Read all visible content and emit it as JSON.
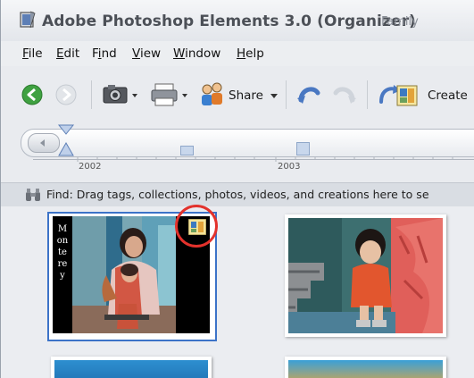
{
  "titlebar": {
    "title": "Adobe Photoshop Elements 3.0 (Organizer)",
    "subtitle": "Family"
  },
  "menu": {
    "items": [
      "File",
      "Edit",
      "Find",
      "View",
      "Window",
      "Help"
    ],
    "underline": [
      "F",
      "E",
      "i",
      "V",
      "W",
      "H"
    ]
  },
  "toolbar": {
    "share_label": "Share",
    "create_label": "Create"
  },
  "timeline": {
    "years": [
      "2002",
      "2003"
    ]
  },
  "findbar": {
    "text": "Find: Drag tags, collections, photos, videos, and creations here to se"
  },
  "photos": [
    {
      "caption_vertical": "Monterey",
      "selected": true,
      "has_creation_badge": true
    },
    {
      "selected": false
    }
  ],
  "colors": {
    "selection": "#3c73c8",
    "annotation_ring": "#e3322c",
    "toolbar_green": "#3fa141"
  }
}
